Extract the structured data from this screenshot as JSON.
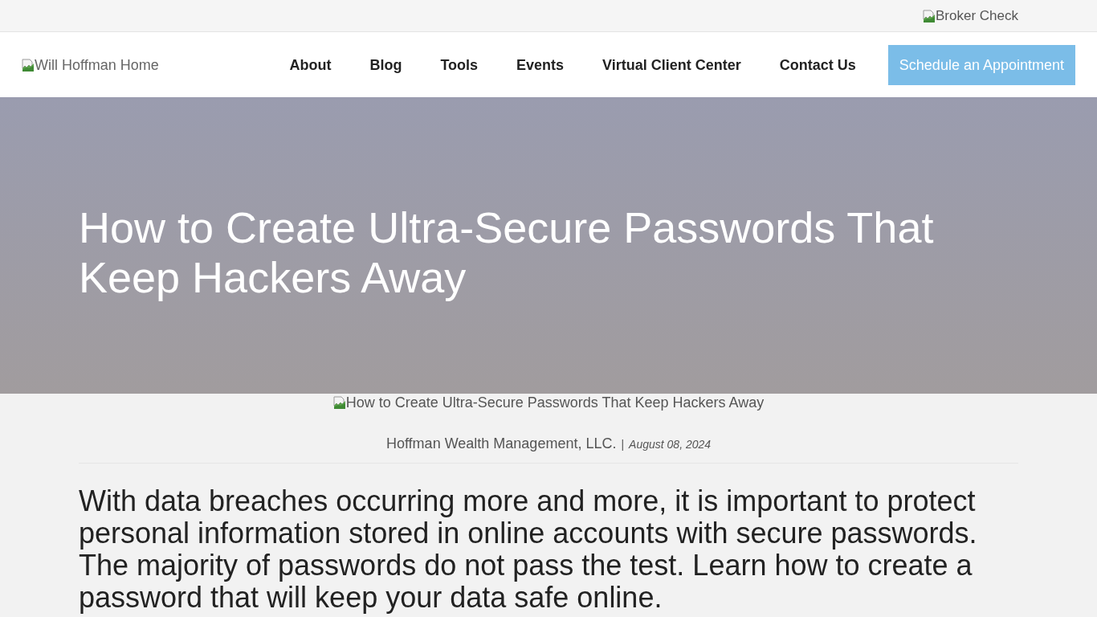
{
  "top_bar": {
    "broker_check_image_alt": "Broker Check"
  },
  "header": {
    "logo_image_alt": "Will Hoffman Home",
    "nav": [
      {
        "label": "About"
      },
      {
        "label": "Blog"
      },
      {
        "label": "Tools"
      },
      {
        "label": "Events"
      },
      {
        "label": "Virtual Client Center"
      },
      {
        "label": "Contact Us"
      }
    ],
    "cta_button": "Schedule an Appointment"
  },
  "hero": {
    "title": "How to Create Ultra-Secure Passwords That Keep Hackers Away"
  },
  "article": {
    "image_alt": "How to Create Ultra-Secure Passwords That Keep Hackers Away",
    "author": "Hoffman Wealth Management, LLC.",
    "separator": "|",
    "date": "August 08, 2024",
    "intro": "With data breaches occurring more and more, it is important to protect personal information stored in online accounts with secure passwords. The majority of passwords do not pass the test. Learn how to create a password that will keep your data safe online."
  }
}
